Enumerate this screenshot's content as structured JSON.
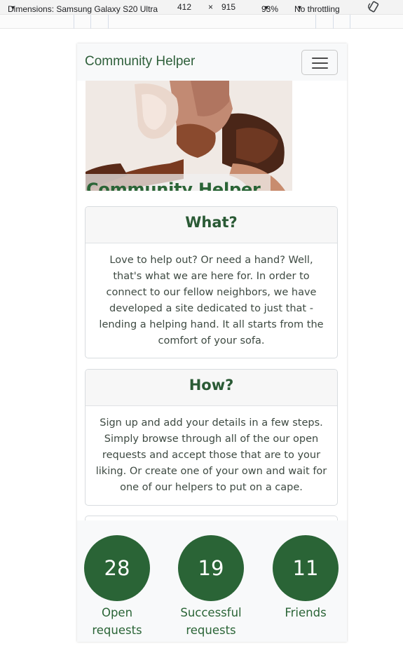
{
  "devtools": {
    "device": "Dimensions: Samsung Galaxy S20 Ultra",
    "width": "412",
    "times": "×",
    "height": "915",
    "zoom": "93%",
    "throttling": "No throttling",
    "caret": "▼"
  },
  "navbar": {
    "brand": "Community Helper"
  },
  "hero": {
    "title": "Community Helper"
  },
  "cards": [
    {
      "title": "What?",
      "body": "Love to help out? Or need a hand? Well, that's what we are here for. In order to connect to our fellow neighbors, we have developed a site dedicated to just that - lending a helping hand. It all starts from the comfort of your sofa."
    },
    {
      "title": "How?",
      "body": "Sign up and add your details in a few steps. Simply browse through all of the our open requests and accept those that are to your liking. Or create one of your own and wait for one of our helpers to put on a cape."
    }
  ],
  "stats": [
    {
      "value": "28",
      "label": "Open requests"
    },
    {
      "value": "19",
      "label": "Successful requests"
    },
    {
      "value": "11",
      "label": "Friends"
    }
  ],
  "colors": {
    "brand_green": "#2a6436",
    "navbar_bg": "#f8f9fa"
  },
  "icons": {
    "menu": "hamburger-menu-icon",
    "rotate": "rotate-icon"
  }
}
